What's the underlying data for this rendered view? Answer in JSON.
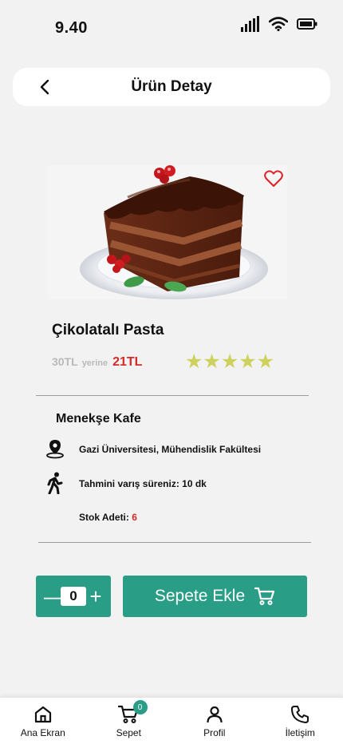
{
  "status_bar": {
    "time": "9.40"
  },
  "header": {
    "title": "Ürün Detay"
  },
  "product": {
    "name": "Çikolatalı Pasta",
    "old_price": "30TL",
    "old_price_word": "yerine",
    "new_price": "21TL",
    "rating": 5,
    "stars": "★★★★★"
  },
  "shop": {
    "name": "Menekşe Kafe",
    "location": "Gazi Üniversitesi, Mühendislik Fakültesi",
    "delivery_time": "Tahmini varış süreniz: 10 dk",
    "stock_label": "Stok Adeti:",
    "stock_value": "6"
  },
  "actions": {
    "quantity": "0",
    "minus": "—",
    "plus": "+",
    "add_to_cart_label": "Sepete Ekle"
  },
  "bottom_nav": {
    "items": [
      {
        "label": "Ana Ekran",
        "icon": "home-icon"
      },
      {
        "label": "Sepet",
        "icon": "cart-icon",
        "badge": "0"
      },
      {
        "label": "Profil",
        "icon": "user-icon"
      },
      {
        "label": "İletişim",
        "icon": "phone-icon"
      }
    ]
  },
  "colors": {
    "accent": "#2a9d86",
    "price_red": "#d62a2a",
    "star": "#cfd15e",
    "background": "#f2f2f2"
  }
}
